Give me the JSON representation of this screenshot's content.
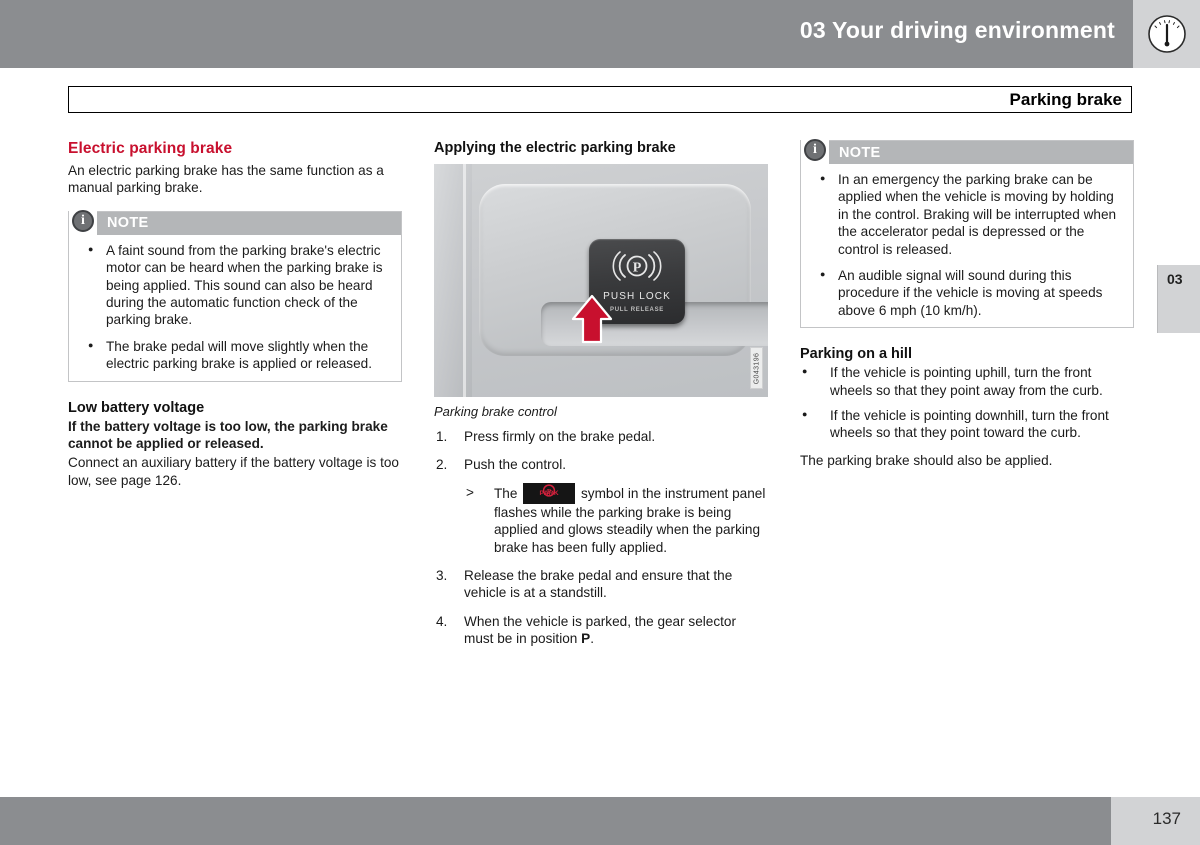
{
  "header": {
    "chapter_title": "03 Your driving environment",
    "chapter_tab": "03",
    "gauge_icon": "gauge-icon",
    "section_title": "Parking brake"
  },
  "footer": {
    "page_number": "137"
  },
  "left_column": {
    "heading": "Electric parking brake",
    "intro": "An electric parking brake has the same function as a manual parking brake.",
    "note": {
      "title": "NOTE",
      "icon": "info-icon",
      "items": [
        "A faint sound from the parking brake's electric motor can be heard when the parking brake is being applied. This sound can also be heard during the automatic function check of the parking brake.",
        "The brake pedal will move slightly when the electric parking brake is applied or released."
      ]
    },
    "low_battery": {
      "heading": "Low battery voltage",
      "bold_text": "If the battery voltage is too low, the parking brake cannot be applied or released.",
      "body_text": "Connect an auxiliary battery if the battery voltage is too low, see page 126."
    }
  },
  "middle_column": {
    "heading": "Applying the electric parking brake",
    "figure": {
      "button_label_push": "PUSH LOCK",
      "button_label_pull": "PULL RELEASE",
      "button_symbol": "parking-brake-p-icon",
      "arrow": "red-up-arrow-icon",
      "image_code": "G043196",
      "caption": "Parking brake control"
    },
    "steps": [
      {
        "num": "1.",
        "text": "Press firmly on the brake pedal."
      },
      {
        "num": "2.",
        "text": "Push the control."
      },
      {
        "num": "3.",
        "text": "Release the brake pedal and ensure that the vehicle is at a standstill."
      },
      {
        "num": "4.",
        "text": "When the vehicle is parked, the gear selector must be in position P."
      }
    ],
    "substep": {
      "marker": ">",
      "text_before": "The",
      "symbol_label": "PARK",
      "symbol_name": "park-warning-symbol",
      "text_after": "symbol in the instrument panel flashes while the parking brake is being applied and glows steadily when the parking brake has been fully applied."
    },
    "step4_parts": {
      "before": "When the vehicle is parked, the gear selector must be in position ",
      "bold": "P",
      "after": "."
    }
  },
  "right_column": {
    "note": {
      "title": "NOTE",
      "icon": "info-icon",
      "items": [
        "In an emergency the parking brake can be applied when the vehicle is moving by holding in the control. Braking will be interrupted when the accelerator pedal is depressed or the control is released.",
        "An audible signal will sound during this procedure if the vehicle is moving at speeds above 6 mph (10 km/h)."
      ]
    },
    "hill": {
      "heading": "Parking on a hill",
      "items": [
        "If the vehicle is pointing uphill, turn the front wheels so that they point away from the curb.",
        "If the vehicle is pointing downhill, turn the front wheels so that they point toward the curb."
      ],
      "footer_text": "The parking brake should also be applied."
    }
  },
  "colors": {
    "header_gray": "#8b8d90",
    "tab_gray": "#d2d3d5",
    "note_header_gray": "#b4b6b8",
    "accent_red": "#c8102e",
    "symbol_red": "#d4213d"
  }
}
